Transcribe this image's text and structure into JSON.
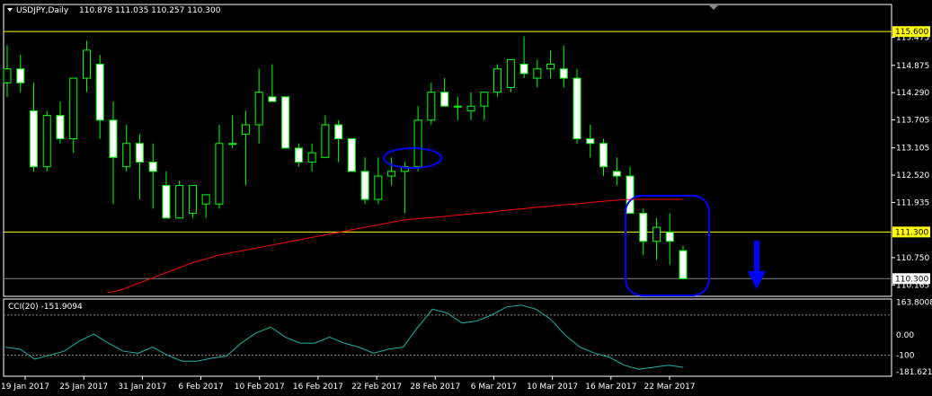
{
  "colors": {
    "background": "#000000",
    "frame": "#ffffff",
    "bull_body": "#000000",
    "bear_body": "#ffffff",
    "wick": "#00ff00",
    "ma": "#ff0000",
    "level_line": "#ffff00",
    "level_tag_bg": "#ffff00",
    "cci": "#20b2aa",
    "annotation": "#0000ff",
    "current_price_line": "#808080"
  },
  "header": {
    "symbol_timeframe": "USDJPY,Daily",
    "ohlc": "110.878 111.035 110.257 110.300",
    "dropdown_icon": "triangle-down-icon"
  },
  "cci_header": {
    "label": "CCI(20)",
    "value": "-151.9094"
  },
  "chart_data": [
    {
      "type": "candlestick",
      "title": "USDJPY,Daily",
      "y_ticks": [
        "115.475",
        "114.875",
        "114.290",
        "113.705",
        "113.105",
        "112.520",
        "111.935",
        "110.750",
        "110.165"
      ],
      "y_range": [
        109.92,
        115.95
      ],
      "price_levels": [
        {
          "label": "115.600",
          "value": 115.6
        },
        {
          "label": "111.300",
          "value": 111.3
        },
        {
          "label": "110.300",
          "value": 110.3
        }
      ],
      "x_labels": [
        "19 Jan 2017",
        "25 Jan 2017",
        "31 Jan 2017",
        "6 Feb 2017",
        "10 Feb 2017",
        "16 Feb 2017",
        "22 Feb 2017",
        "28 Feb 2017",
        "6 Mar 2017",
        "10 Mar 2017",
        "16 Mar 2017",
        "22 Mar 2017"
      ],
      "candles": [
        {
          "o": 114.5,
          "h": 115.3,
          "l": 114.2,
          "c": 114.8
        },
        {
          "o": 114.8,
          "h": 115.1,
          "l": 114.3,
          "c": 114.5
        },
        {
          "o": 113.9,
          "h": 114.5,
          "l": 112.6,
          "c": 112.7
        },
        {
          "o": 112.7,
          "h": 113.9,
          "l": 112.6,
          "c": 113.8
        },
        {
          "o": 113.8,
          "h": 114.1,
          "l": 113.2,
          "c": 113.3
        },
        {
          "o": 113.3,
          "h": 114.6,
          "l": 113.0,
          "c": 114.6
        },
        {
          "o": 114.6,
          "h": 115.4,
          "l": 114.3,
          "c": 115.2
        },
        {
          "o": 114.9,
          "h": 115.1,
          "l": 113.3,
          "c": 113.7
        },
        {
          "o": 113.7,
          "h": 114.1,
          "l": 111.9,
          "c": 112.9
        },
        {
          "o": 112.7,
          "h": 113.6,
          "l": 112.6,
          "c": 113.2
        },
        {
          "o": 113.2,
          "h": 113.4,
          "l": 112.0,
          "c": 112.8
        },
        {
          "o": 112.8,
          "h": 113.2,
          "l": 111.8,
          "c": 112.6
        },
        {
          "o": 112.3,
          "h": 112.6,
          "l": 111.8,
          "c": 111.6
        },
        {
          "o": 111.6,
          "h": 112.4,
          "l": 111.6,
          "c": 112.3
        },
        {
          "o": 111.7,
          "h": 112.3,
          "l": 111.6,
          "c": 112.3
        },
        {
          "o": 111.9,
          "h": 112.1,
          "l": 111.6,
          "c": 112.1
        },
        {
          "o": 111.9,
          "h": 113.6,
          "l": 111.8,
          "c": 113.2
        },
        {
          "o": 113.2,
          "h": 113.8,
          "l": 113.1,
          "c": 113.2
        },
        {
          "o": 113.4,
          "h": 113.9,
          "l": 112.3,
          "c": 113.6
        },
        {
          "o": 113.6,
          "h": 114.8,
          "l": 113.2,
          "c": 114.3
        },
        {
          "o": 114.2,
          "h": 114.9,
          "l": 114.1,
          "c": 114.1
        },
        {
          "o": 114.2,
          "h": 114.2,
          "l": 113.1,
          "c": 113.1
        },
        {
          "o": 113.1,
          "h": 113.2,
          "l": 112.7,
          "c": 112.8
        },
        {
          "o": 112.8,
          "h": 113.2,
          "l": 112.6,
          "c": 113.0
        },
        {
          "o": 112.9,
          "h": 113.8,
          "l": 112.9,
          "c": 113.6
        },
        {
          "o": 113.6,
          "h": 113.7,
          "l": 112.8,
          "c": 113.3
        },
        {
          "o": 113.3,
          "h": 113.3,
          "l": 112.6,
          "c": 112.6
        },
        {
          "o": 112.6,
          "h": 112.9,
          "l": 111.9,
          "c": 112.0
        },
        {
          "o": 112.0,
          "h": 112.9,
          "l": 111.9,
          "c": 112.5
        },
        {
          "o": 112.5,
          "h": 112.9,
          "l": 112.3,
          "c": 112.6
        },
        {
          "o": 112.6,
          "h": 112.8,
          "l": 111.7,
          "c": 112.7
        },
        {
          "o": 112.7,
          "h": 114.0,
          "l": 112.6,
          "c": 113.7
        },
        {
          "o": 113.7,
          "h": 114.5,
          "l": 113.6,
          "c": 114.3
        },
        {
          "o": 114.3,
          "h": 114.6,
          "l": 114.0,
          "c": 114.0
        },
        {
          "o": 114.0,
          "h": 114.2,
          "l": 113.7,
          "c": 114.0
        },
        {
          "o": 113.9,
          "h": 114.3,
          "l": 113.7,
          "c": 114.0
        },
        {
          "o": 114.0,
          "h": 114.3,
          "l": 113.7,
          "c": 114.3
        },
        {
          "o": 114.3,
          "h": 114.9,
          "l": 114.2,
          "c": 114.8
        },
        {
          "o": 114.4,
          "h": 115.0,
          "l": 114.3,
          "c": 115.0
        },
        {
          "o": 114.9,
          "h": 115.5,
          "l": 114.6,
          "c": 114.7
        },
        {
          "o": 114.6,
          "h": 115.0,
          "l": 114.4,
          "c": 114.8
        },
        {
          "o": 114.8,
          "h": 115.2,
          "l": 114.6,
          "c": 114.9
        },
        {
          "o": 114.8,
          "h": 115.3,
          "l": 114.4,
          "c": 114.6
        },
        {
          "o": 114.6,
          "h": 114.8,
          "l": 113.2,
          "c": 113.3
        },
        {
          "o": 113.3,
          "h": 113.6,
          "l": 112.9,
          "c": 113.2
        },
        {
          "o": 113.2,
          "h": 113.3,
          "l": 112.5,
          "c": 112.7
        },
        {
          "o": 112.6,
          "h": 112.9,
          "l": 112.3,
          "c": 112.5
        },
        {
          "o": 112.5,
          "h": 112.7,
          "l": 111.7,
          "c": 111.7
        },
        {
          "o": 111.7,
          "h": 111.8,
          "l": 110.8,
          "c": 111.1
        },
        {
          "o": 111.1,
          "h": 111.6,
          "l": 110.7,
          "c": 111.4
        },
        {
          "o": 111.3,
          "h": 111.7,
          "l": 110.6,
          "c": 111.1
        },
        {
          "o": 110.9,
          "h": 111.0,
          "l": 110.3,
          "c": 110.3
        }
      ],
      "ma_series": [
        110.0,
        110.05,
        110.15,
        110.25,
        110.35,
        110.45,
        110.55,
        110.65,
        110.72,
        110.8,
        110.85,
        110.9,
        110.95,
        111.0,
        111.05,
        111.1,
        111.15,
        111.2,
        111.25,
        111.3,
        111.35,
        111.4,
        111.45,
        111.5,
        111.55,
        111.58,
        111.6,
        111.62,
        111.65,
        111.67,
        111.7,
        111.72,
        111.75,
        111.78,
        111.8,
        111.83,
        111.85,
        111.88,
        111.9,
        111.92,
        111.95,
        111.97,
        111.99,
        112.0,
        112.0,
        112.0,
        112.0,
        112.0
      ]
    },
    {
      "type": "line",
      "title": "CCI(20)",
      "y_ticks": [
        "163.8008",
        "0.00",
        "-100",
        "-181.6211"
      ],
      "y_range": [
        -205,
        180
      ],
      "levels": [
        100,
        -100
      ],
      "series": [
        {
          "name": "CCI(20)",
          "values": [
            -60,
            -70,
            -120,
            -100,
            -80,
            -30,
            5,
            -40,
            -80,
            -90,
            -60,
            -100,
            -130,
            -130,
            -115,
            -105,
            -40,
            10,
            40,
            -10,
            -40,
            -40,
            -10,
            -40,
            -60,
            -90,
            -70,
            -60,
            40,
            130,
            110,
            60,
            70,
            100,
            140,
            150,
            130,
            80,
            0,
            -60,
            -90,
            -110,
            -150,
            -170,
            -160,
            -150,
            -160
          ]
        }
      ]
    }
  ],
  "annotations": {
    "ellipse_icon": "ellipse-highlight-icon",
    "box_icon": "rounded-box-highlight-icon",
    "arrow_icon": "down-arrow-icon"
  }
}
